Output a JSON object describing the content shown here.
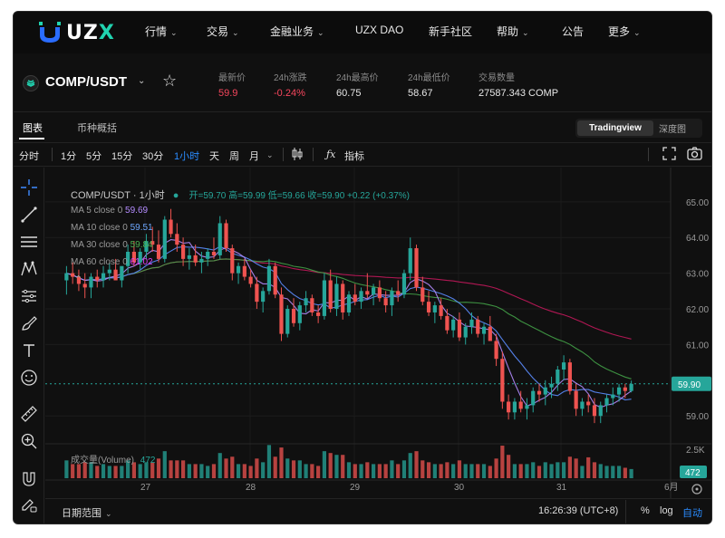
{
  "brand": {
    "name_pre": "U",
    "name_mid": "Z",
    "name_post": "X"
  },
  "nav": {
    "items": [
      {
        "label": "行情",
        "dropdown": true
      },
      {
        "label": "交易",
        "dropdown": true
      },
      {
        "label": "金融业务",
        "dropdown": true
      },
      {
        "label": "UZX DAO",
        "dropdown": false
      },
      {
        "label": "新手社区",
        "dropdown": false
      },
      {
        "label": "帮助",
        "dropdown": true
      },
      {
        "label": "公告",
        "dropdown": false
      },
      {
        "label": "更多",
        "dropdown": true
      }
    ]
  },
  "ticker": {
    "pair": "COMP/USDT",
    "stats": [
      {
        "label": "最新价",
        "value": "59.9",
        "color": "#f6465d"
      },
      {
        "label": "24h涨跌",
        "value": "-0.24%",
        "color": "#f6465d"
      },
      {
        "label": "24h最高价",
        "value": "60.75",
        "color": "#e8e8e8"
      },
      {
        "label": "24h最低价",
        "value": "58.67",
        "color": "#e8e8e8"
      },
      {
        "label": "交易数量",
        "value": "27587.343 COMP",
        "color": "#e8e8e8"
      }
    ]
  },
  "tabs": {
    "chart": "图表",
    "overview": "币种概括",
    "tradingview": "Tradingview",
    "depth": "深度图"
  },
  "toolbar": {
    "timeshare": "分时",
    "intervals": [
      "1分",
      "5分",
      "15分",
      "30分",
      "1小时",
      "天",
      "周",
      "月"
    ],
    "active_interval": "1小时",
    "indicators": "指标"
  },
  "chart_legend": {
    "symbol_line": "COMP/USDT · 1小时",
    "ohlc": "开=59.70 高=59.99 低=59.66 收=59.90 +0.22 (+0.37%)",
    "ma": [
      {
        "label": "MA 5 close 0",
        "value": "59.69",
        "color": "#b48cff"
      },
      {
        "label": "MA 10 close 0",
        "value": "59.51",
        "color": "#6ea8ff"
      },
      {
        "label": "MA 30 close 0",
        "value": "59.84",
        "color": "#4caf50"
      },
      {
        "label": "MA 60 close 0",
        "value": "61.02",
        "color": "#e040fb"
      }
    ],
    "volume_label": "成交量(Volume)",
    "volume_value": "472"
  },
  "axis": {
    "price_ticks": [
      "65.00",
      "64.00",
      "63.00",
      "62.00",
      "61.00",
      "59.00"
    ],
    "last_price": "59.90",
    "volume_tick": "2.5K",
    "volume_last": "472",
    "date_ticks": [
      "27",
      "28",
      "29",
      "30",
      "31",
      "6月"
    ]
  },
  "bottom": {
    "date_range": "日期范围",
    "clock": "16:26:39 (UTC+8)",
    "percent": "%",
    "log": "log",
    "auto": "自动"
  },
  "colors": {
    "up": "#26a69a",
    "down": "#ef5350",
    "accent": "#2a8cff"
  },
  "chart_data": {
    "type": "candlestick",
    "symbol": "COMP/USDT",
    "interval": "1小时",
    "ylim": [
      58.6,
      65.3
    ],
    "candles": [
      [
        62.8,
        63.2,
        62.4,
        63.0
      ],
      [
        63.0,
        63.3,
        62.7,
        62.9
      ],
      [
        62.9,
        63.1,
        62.5,
        62.7
      ],
      [
        62.7,
        63.0,
        62.3,
        62.6
      ],
      [
        62.6,
        63.0,
        62.3,
        62.9
      ],
      [
        62.9,
        63.1,
        62.6,
        62.8
      ],
      [
        62.8,
        63.2,
        62.6,
        63.0
      ],
      [
        63.0,
        63.3,
        62.8,
        63.1
      ],
      [
        63.1,
        63.4,
        62.9,
        62.8
      ],
      [
        62.8,
        63.1,
        62.6,
        63.2
      ],
      [
        63.2,
        63.8,
        63.0,
        63.6
      ],
      [
        63.6,
        63.9,
        63.2,
        63.3
      ],
      [
        63.3,
        63.7,
        63.1,
        63.6
      ],
      [
        63.6,
        64.1,
        63.4,
        63.9
      ],
      [
        63.9,
        64.3,
        63.6,
        63.8
      ],
      [
        63.8,
        64.2,
        63.3,
        63.4
      ],
      [
        63.4,
        64.6,
        63.3,
        64.5
      ],
      [
        64.5,
        64.8,
        64.0,
        64.1
      ],
      [
        64.1,
        64.4,
        63.6,
        63.8
      ],
      [
        63.8,
        64.0,
        63.2,
        63.4
      ],
      [
        63.4,
        63.7,
        63.1,
        63.5
      ],
      [
        63.5,
        63.8,
        63.2,
        63.3
      ],
      [
        63.3,
        63.6,
        63.0,
        63.4
      ],
      [
        63.4,
        63.7,
        63.2,
        63.6
      ],
      [
        63.6,
        64.0,
        63.4,
        63.5
      ],
      [
        63.5,
        64.6,
        63.4,
        64.4
      ],
      [
        64.4,
        64.5,
        63.6,
        63.7
      ],
      [
        63.7,
        63.8,
        62.8,
        63.0
      ],
      [
        63.0,
        63.3,
        62.7,
        63.2
      ],
      [
        63.2,
        63.4,
        62.8,
        62.9
      ],
      [
        62.9,
        63.1,
        62.6,
        62.7
      ],
      [
        62.7,
        62.9,
        62.0,
        62.2
      ],
      [
        62.2,
        62.6,
        61.9,
        62.5
      ],
      [
        62.5,
        63.4,
        62.4,
        63.2
      ],
      [
        63.2,
        63.3,
        62.3,
        62.4
      ],
      [
        62.4,
        62.6,
        61.1,
        61.3
      ],
      [
        61.3,
        62.1,
        61.2,
        62.0
      ],
      [
        62.0,
        62.3,
        61.5,
        61.6
      ],
      [
        61.6,
        62.2,
        61.4,
        62.1
      ],
      [
        62.1,
        62.5,
        61.9,
        62.3
      ],
      [
        62.3,
        62.4,
        61.8,
        61.9
      ],
      [
        61.9,
        62.1,
        61.6,
        61.8
      ],
      [
        61.8,
        63.0,
        61.7,
        62.8
      ],
      [
        62.8,
        63.1,
        61.9,
        62.0
      ],
      [
        62.0,
        62.9,
        61.8,
        62.7
      ],
      [
        62.7,
        62.8,
        61.7,
        61.9
      ],
      [
        61.9,
        62.5,
        61.8,
        62.4
      ],
      [
        62.4,
        62.7,
        62.1,
        62.2
      ],
      [
        62.2,
        62.6,
        62.0,
        62.5
      ],
      [
        62.5,
        63.0,
        62.3,
        62.4
      ],
      [
        62.4,
        62.7,
        62.1,
        62.6
      ],
      [
        62.6,
        62.8,
        62.2,
        62.3
      ],
      [
        62.3,
        62.5,
        61.9,
        62.1
      ],
      [
        62.1,
        62.6,
        61.8,
        62.5
      ],
      [
        62.5,
        62.8,
        62.2,
        62.4
      ],
      [
        62.4,
        63.1,
        62.3,
        63.0
      ],
      [
        63.0,
        64.0,
        62.8,
        63.7
      ],
      [
        63.7,
        63.8,
        62.5,
        62.6
      ],
      [
        62.6,
        62.9,
        62.1,
        62.2
      ],
      [
        62.2,
        62.5,
        61.8,
        61.9
      ],
      [
        61.9,
        62.2,
        61.6,
        62.1
      ],
      [
        62.1,
        62.3,
        61.7,
        61.8
      ],
      [
        61.8,
        62.0,
        61.3,
        61.4
      ],
      [
        61.4,
        61.8,
        61.2,
        61.7
      ],
      [
        61.7,
        61.9,
        61.1,
        61.2
      ],
      [
        61.2,
        61.6,
        61.0,
        61.5
      ],
      [
        61.5,
        61.9,
        61.3,
        61.7
      ],
      [
        61.7,
        61.8,
        61.2,
        61.3
      ],
      [
        61.3,
        61.6,
        61.0,
        61.5
      ],
      [
        61.5,
        61.8,
        61.3,
        61.1
      ],
      [
        61.1,
        61.3,
        60.4,
        60.6
      ],
      [
        60.6,
        60.8,
        59.2,
        59.4
      ],
      [
        59.4,
        59.6,
        58.9,
        59.1
      ],
      [
        59.1,
        59.5,
        58.9,
        59.4
      ],
      [
        59.4,
        59.7,
        59.1,
        59.2
      ],
      [
        59.2,
        59.5,
        58.9,
        59.3
      ],
      [
        59.3,
        59.8,
        59.1,
        59.7
      ],
      [
        59.7,
        59.9,
        59.4,
        59.6
      ],
      [
        59.6,
        60.0,
        59.3,
        59.8
      ],
      [
        59.8,
        60.1,
        59.5,
        59.9
      ],
      [
        59.9,
        60.4,
        59.7,
        60.3
      ],
      [
        60.3,
        60.7,
        60.0,
        60.5
      ],
      [
        60.5,
        60.6,
        59.6,
        59.7
      ],
      [
        59.7,
        59.9,
        59.0,
        59.2
      ],
      [
        59.2,
        59.5,
        59.0,
        59.4
      ],
      [
        59.4,
        59.6,
        59.1,
        59.3
      ],
      [
        59.3,
        59.5,
        58.8,
        59.0
      ],
      [
        59.0,
        59.4,
        58.8,
        59.3
      ],
      [
        59.3,
        59.6,
        59.1,
        59.5
      ],
      [
        59.5,
        59.8,
        59.3,
        59.6
      ],
      [
        59.6,
        59.9,
        59.4,
        59.8
      ],
      [
        59.8,
        59.9,
        59.5,
        59.7
      ],
      [
        59.7,
        59.99,
        59.66,
        59.9
      ]
    ],
    "volume_max": 2800
  }
}
